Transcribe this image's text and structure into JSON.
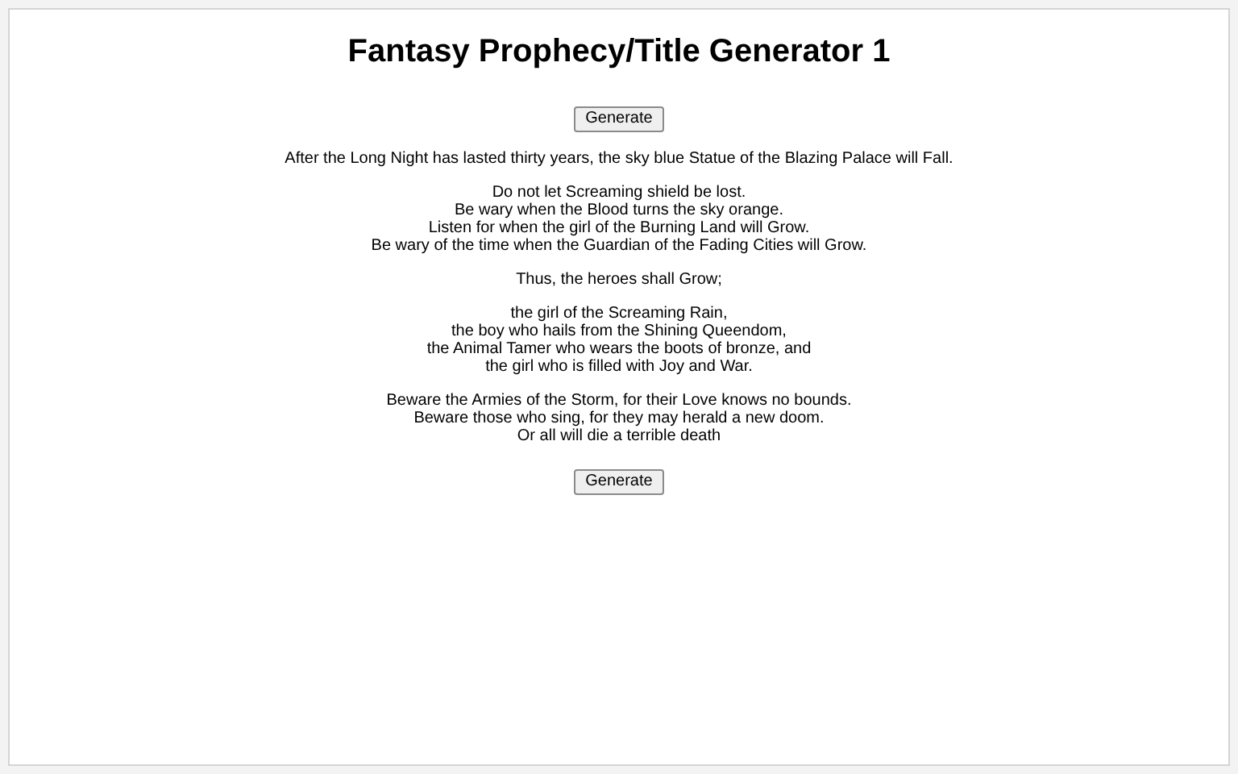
{
  "title": "Fantasy Prophecy/Title Generator 1",
  "buttons": [
    "Generate",
    "Generate"
  ],
  "paragraphs": [
    [
      "After the Long Night has lasted thirty years, the sky blue Statue of the Blazing Palace will Fall."
    ],
    [
      "Do not let Screaming shield be lost.",
      "Be wary when the Blood turns the sky orange.",
      "Listen for when the girl of the Burning Land will Grow.",
      "Be wary of the time when the Guardian of the Fading Cities will Grow."
    ],
    [
      "Thus, the heroes shall Grow;"
    ],
    [
      "the girl of the Screaming Rain,",
      "the boy who hails from the Shining Queendom,",
      "the Animal Tamer who wears the boots of bronze, and",
      "the girl who is filled with Joy and War."
    ],
    [
      "Beware the Armies of the Storm, for their Love knows no bounds.",
      "Beware those who sing, for they may herald a new doom.",
      "Or all will die a terrible death"
    ]
  ]
}
